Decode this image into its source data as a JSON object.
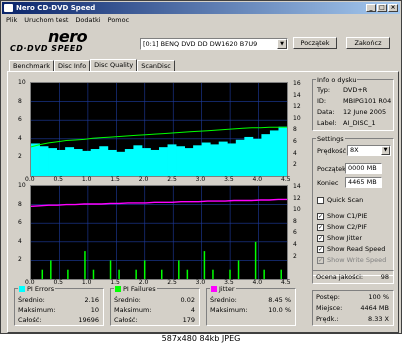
{
  "window": {
    "title": "Nero CD-DVD Speed"
  },
  "menu": [
    "Plik",
    "Uruchom test",
    "Dodatki",
    "Pomoc"
  ],
  "logo": {
    "main": "nero",
    "sub": "CD·DVD SPEED"
  },
  "drive": {
    "selected": "[0:1]  BENQ DVD DD DW1620 B7U9"
  },
  "buttons": {
    "start": "Początek",
    "stop": "Zakończ"
  },
  "tabs": [
    "Benchmark",
    "Disc Info",
    "Disc Quality",
    "ScanDisc"
  ],
  "active_tab": "Disc Quality",
  "disc_info": {
    "title": "Info o dysku",
    "type_label": "Typ:",
    "type_value": "DVD+R",
    "id_label": "ID:",
    "id_value": "MBIPG101 R04",
    "date_label": "Data:",
    "date_value": "12 June 2005",
    "label_label": "Label:",
    "label_value": "AI_DISC_1"
  },
  "settings": {
    "title": "Settings",
    "speed_label": "Prędkość",
    "speed_value": "8X",
    "start_label": "Początek",
    "start_value": "0000 MB",
    "end_label": "Koniec",
    "end_value": "4465 MB",
    "quick_scan": "Quick Scan",
    "show_c1": "Show C1/PIE",
    "show_c2": "Show C2/PIF",
    "show_jitter": "Show Jitter",
    "show_read": "Show Read Speed",
    "show_write": "Show Write Speed"
  },
  "quality": {
    "label": "Ocena jakości:",
    "value": "98"
  },
  "stats": {
    "pi_errors": {
      "title": "PI Errors",
      "avg_label": "Średnio:",
      "avg": "2.16",
      "max_label": "Maksimum:",
      "max": "10",
      "total_label": "Całość:",
      "total": "19696"
    },
    "pi_failures": {
      "title": "PI Failures",
      "avg_label": "Średnio:",
      "avg": "0.02",
      "max_label": "Maksimum:",
      "max": "4",
      "total_label": "Całość:",
      "total": "179"
    },
    "jitter": {
      "title": "Jitter",
      "avg_label": "Średnio:",
      "avg": "8.45 %",
      "max_label": "Maksimum:",
      "max": "10.0 %"
    }
  },
  "progress": {
    "progress_label": "Postęp:",
    "progress_value": "100 %",
    "position_label": "Miejsce:",
    "position_value": "4464 MB",
    "speed_label": "Prędk.:",
    "speed_value": "8.33 X"
  },
  "colors": {
    "pie": "#00ffff",
    "pif": "#00ff00",
    "jitter": "#ff00ff",
    "read": "#00ff00",
    "accent": "#0a246a"
  },
  "chart_data": [
    {
      "type": "area",
      "x_ticks": [
        "0.0",
        "0.5",
        "1.0",
        "1.5",
        "2.0",
        "2.5",
        "3.0",
        "3.5",
        "4.0",
        "4.5"
      ],
      "y_left_ticks": [
        "10",
        "8",
        "6",
        "4",
        "2"
      ],
      "y_right_ticks": [
        "16",
        "14",
        "12",
        "10",
        "8",
        "6",
        "4",
        "2"
      ],
      "xlim": [
        0,
        4.5
      ],
      "ylim_left": [
        0,
        10
      ],
      "ylim_right": [
        0,
        16
      ],
      "series": [
        {
          "values": [
            3.5,
            3.2,
            3.0,
            2.8,
            3.1,
            2.9,
            2.7,
            2.9,
            3.2,
            2.8,
            2.6,
            2.9,
            3.3,
            3.0,
            2.8,
            3.1,
            3.4,
            3.2,
            3.0,
            3.3,
            3.6,
            3.4,
            3.7,
            3.5,
            3.9,
            4.2,
            4.0,
            4.5,
            4.9,
            5.3
          ]
        },
        {
          "values": [
            5.0,
            5.4,
            5.7,
            5.9,
            6.1,
            6.2,
            6.3,
            6.5,
            6.6,
            6.7,
            6.8,
            6.9,
            7.0,
            7.1,
            7.2,
            7.3,
            7.4,
            7.5,
            7.6,
            7.7,
            7.8,
            7.9,
            8.0,
            8.1,
            8.2,
            8.3,
            8.3,
            8.4,
            8.4,
            8.4
          ]
        }
      ]
    },
    {
      "type": "bar",
      "x_ticks": [
        "0.0",
        "0.5",
        "1.0",
        "1.5",
        "2.0",
        "2.5",
        "3.0",
        "3.5",
        "4.0",
        "4.5"
      ],
      "y_left_ticks": [
        "10",
        "8",
        "6",
        "4",
        "2"
      ],
      "y_right_ticks": [
        "14",
        "12",
        "10",
        "8",
        "6",
        "4",
        "2"
      ],
      "xlim": [
        0,
        4.5
      ],
      "ylim_left": [
        0,
        10
      ],
      "ylim_right": [
        0,
        16
      ],
      "series": [
        {
          "values": [
            0,
            1,
            2,
            0,
            1,
            0,
            3,
            1,
            0,
            2,
            1,
            0,
            1,
            2,
            0,
            1,
            0,
            2,
            1,
            0,
            3,
            1,
            0,
            1,
            2,
            0,
            4,
            1,
            0,
            1
          ]
        },
        {
          "values": [
            12.5,
            12.6,
            12.7,
            12.7,
            12.8,
            12.8,
            12.9,
            12.9,
            12.9,
            13.0,
            13.0,
            13.1,
            13.1,
            13.1,
            13.2,
            13.2,
            13.2,
            13.3,
            13.3,
            13.3,
            13.4,
            13.4,
            13.4,
            13.5,
            13.5,
            13.5,
            13.6,
            13.6,
            13.7,
            13.7
          ]
        }
      ]
    }
  ],
  "caption": "587x480  84kb  JPEG"
}
